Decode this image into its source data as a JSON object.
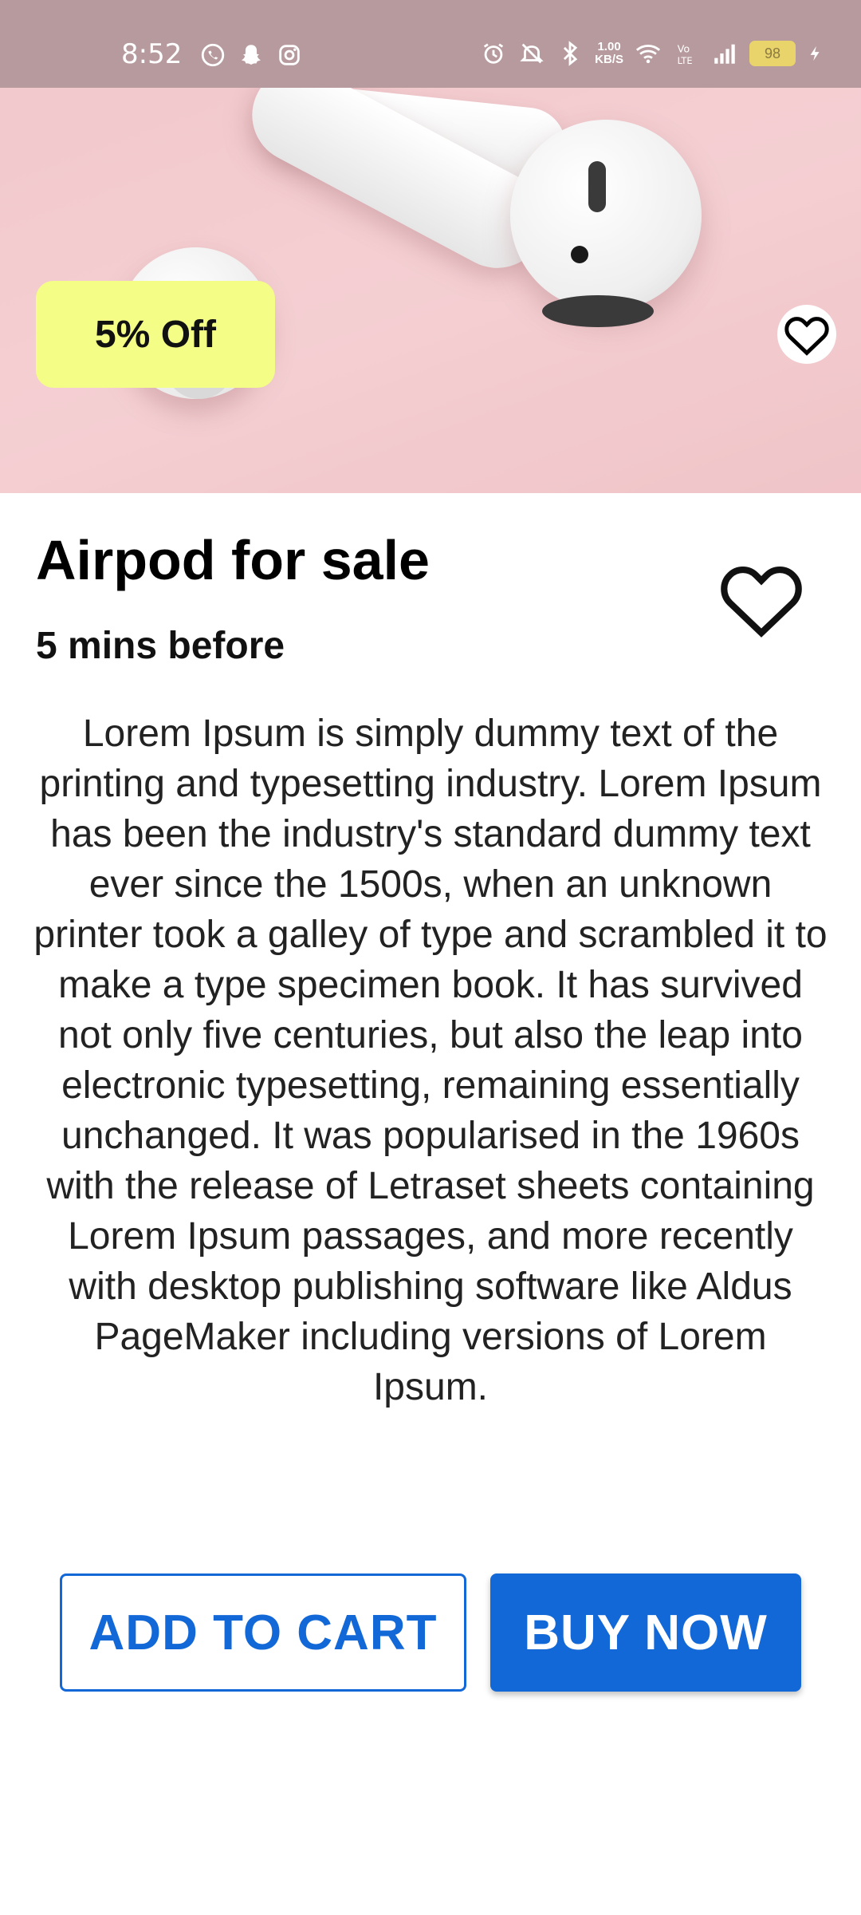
{
  "status_bar": {
    "time": "8:52",
    "net_speed_value": "1.00",
    "net_speed_unit": "KB/S",
    "battery": "98",
    "icons": [
      "whatsapp-icon",
      "snapchat-icon",
      "instagram-icon",
      "alarm-icon",
      "mute-icon",
      "bluetooth-icon",
      "wifi-icon",
      "volte-icon",
      "signal-icon",
      "battery-icon",
      "charging-icon"
    ]
  },
  "hero": {
    "discount_label": "5% Off",
    "favorite_icon": "heart-outline-icon"
  },
  "product": {
    "title": "Airpod for sale",
    "posted": "5 mins before",
    "description": "Lorem Ipsum is simply dummy text of the printing and typesetting industry. Lorem Ipsum has been the industry's standard dummy text ever since the 1500s, when an unknown printer took a galley of type and scrambled it to make a type specimen book. It has survived not only five centuries, but also the leap into electronic typesetting, remaining essentially unchanged. It was popularised in the 1960s with the release of Letraset sheets containing Lorem Ipsum passages, and more recently with desktop publishing software like Aldus PageMaker including versions of Lorem Ipsum."
  },
  "actions": {
    "add_to_cart": "ADD TO CART",
    "buy_now": "BUY NOW"
  },
  "colors": {
    "accent": "#1368d8",
    "badge": "#f4fd86",
    "status_bar": "#b79a9d"
  }
}
